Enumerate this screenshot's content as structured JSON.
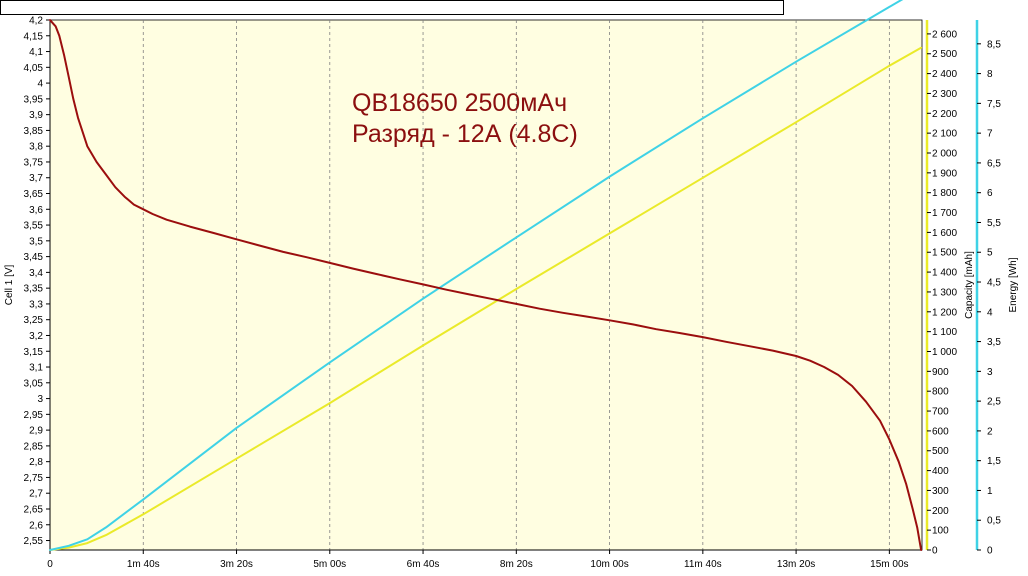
{
  "chart_data": {
    "type": "line",
    "title_lines": [
      "QB18650 2500мАч",
      "Разряд - 12А (4.8С)"
    ],
    "xlabel": "",
    "x_unit": "seconds",
    "xlim": [
      0,
      935
    ],
    "x_ticks": [
      {
        "value": 0,
        "label": "0"
      },
      {
        "value": 100,
        "label": "1m 40s"
      },
      {
        "value": 200,
        "label": "3m 20s"
      },
      {
        "value": 300,
        "label": "5m 00s"
      },
      {
        "value": 400,
        "label": "6m 40s"
      },
      {
        "value": 500,
        "label": "8m 20s"
      },
      {
        "value": 600,
        "label": "10m 00s"
      },
      {
        "value": 700,
        "label": "11m 40s"
      },
      {
        "value": 800,
        "label": "13m 20s"
      },
      {
        "value": 900,
        "label": "15m 00s"
      }
    ],
    "axes": {
      "voltage": {
        "label": "Cell 1 [V]",
        "lim": [
          2.52,
          4.2
        ],
        "ticks": [
          "4,2",
          "4,15",
          "4,1",
          "4,05",
          "4",
          "3,95",
          "3,9",
          "3,85",
          "3,8",
          "3,75",
          "3,7",
          "3,65",
          "3,6",
          "3,55",
          "3,5",
          "3,45",
          "3,4",
          "3,35",
          "3,3",
          "3,25",
          "3,2",
          "3,15",
          "3,1",
          "3,05",
          "3",
          "2,95",
          "2,9",
          "2,85",
          "2,8",
          "2,75",
          "2,7",
          "2,65",
          "2,6",
          "2,55"
        ],
        "tick_values": [
          4.2,
          4.15,
          4.1,
          4.05,
          4.0,
          3.95,
          3.9,
          3.85,
          3.8,
          3.75,
          3.7,
          3.65,
          3.6,
          3.55,
          3.5,
          3.45,
          3.4,
          3.35,
          3.3,
          3.25,
          3.2,
          3.15,
          3.1,
          3.05,
          3.0,
          2.95,
          2.9,
          2.85,
          2.8,
          2.75,
          2.7,
          2.65,
          2.6,
          2.55
        ]
      },
      "capacity": {
        "label": "Capacity [mAh]",
        "lim": [
          0,
          2670
        ],
        "ticks": [
          "2 600",
          "2 500",
          "2 400",
          "2 300",
          "2 200",
          "2 100",
          "2 000",
          "1 900",
          "1 800",
          "1 700",
          "1 600",
          "1 500",
          "1 400",
          "1 300",
          "1 200",
          "1 100",
          "1 000",
          "900",
          "800",
          "700",
          "600",
          "500",
          "400",
          "300",
          "200",
          "100",
          "0"
        ],
        "tick_values": [
          2600,
          2500,
          2400,
          2300,
          2200,
          2100,
          2000,
          1900,
          1800,
          1700,
          1600,
          1500,
          1400,
          1300,
          1200,
          1100,
          1000,
          900,
          800,
          700,
          600,
          500,
          400,
          300,
          200,
          100,
          0
        ]
      },
      "energy": {
        "label": "Energy [Wh]",
        "lim": [
          0,
          8.9
        ],
        "ticks": [
          "8,5",
          "8",
          "7,5",
          "7",
          "6,5",
          "6",
          "5,5",
          "5",
          "4,5",
          "4",
          "3,5",
          "3",
          "2,5",
          "2",
          "1,5",
          "1",
          "0,5",
          "0"
        ],
        "tick_values": [
          8.5,
          8.0,
          7.5,
          7.0,
          6.5,
          6.0,
          5.5,
          5.0,
          4.5,
          4.0,
          3.5,
          3.0,
          2.5,
          2.0,
          1.5,
          1.0,
          0.5,
          0
        ]
      }
    },
    "series": [
      {
        "name": "Cell 1 [V]",
        "axis": "voltage",
        "color": "#9b0e0e",
        "x": [
          0,
          3,
          6,
          10,
          15,
          20,
          25,
          30,
          40,
          50,
          60,
          70,
          80,
          90,
          100,
          110,
          125,
          150,
          175,
          200,
          225,
          250,
          275,
          300,
          325,
          350,
          375,
          400,
          425,
          450,
          475,
          500,
          525,
          550,
          575,
          600,
          625,
          650,
          675,
          700,
          725,
          750,
          775,
          800,
          815,
          830,
          845,
          860,
          875,
          890,
          900,
          910,
          918,
          925,
          930,
          934
        ],
        "y": [
          4.2,
          4.19,
          4.18,
          4.15,
          4.09,
          4.02,
          3.95,
          3.89,
          3.8,
          3.75,
          3.71,
          3.67,
          3.64,
          3.615,
          3.6,
          3.585,
          3.567,
          3.545,
          3.525,
          3.505,
          3.485,
          3.465,
          3.448,
          3.43,
          3.412,
          3.395,
          3.378,
          3.362,
          3.345,
          3.33,
          3.315,
          3.3,
          3.285,
          3.272,
          3.26,
          3.248,
          3.235,
          3.22,
          3.208,
          3.195,
          3.18,
          3.166,
          3.152,
          3.135,
          3.12,
          3.1,
          3.075,
          3.04,
          2.99,
          2.93,
          2.87,
          2.8,
          2.73,
          2.65,
          2.59,
          2.52
        ]
      },
      {
        "name": "Capacity [mAh]",
        "axis": "capacity",
        "color": "#eaea2a",
        "x": [
          0,
          20,
          40,
          60,
          100,
          200,
          300,
          400,
          500,
          600,
          700,
          800,
          900,
          934
        ],
        "y": [
          0,
          12,
          35,
          75,
          180,
          460,
          740,
          1030,
          1315,
          1595,
          1875,
          2155,
          2440,
          2530
        ]
      },
      {
        "name": "Energy [Wh]",
        "axis": "energy",
        "color": "#3fd2e6",
        "x": [
          0,
          20,
          40,
          60,
          100,
          200,
          300,
          400,
          500,
          600,
          700,
          800,
          900,
          934
        ],
        "y": [
          0,
          0.07,
          0.18,
          0.38,
          0.85,
          2.05,
          3.15,
          4.22,
          5.25,
          6.27,
          7.25,
          8.2,
          9.12,
          9.43
        ]
      }
    ],
    "grid": "vertical-dashed",
    "legend": "none"
  }
}
